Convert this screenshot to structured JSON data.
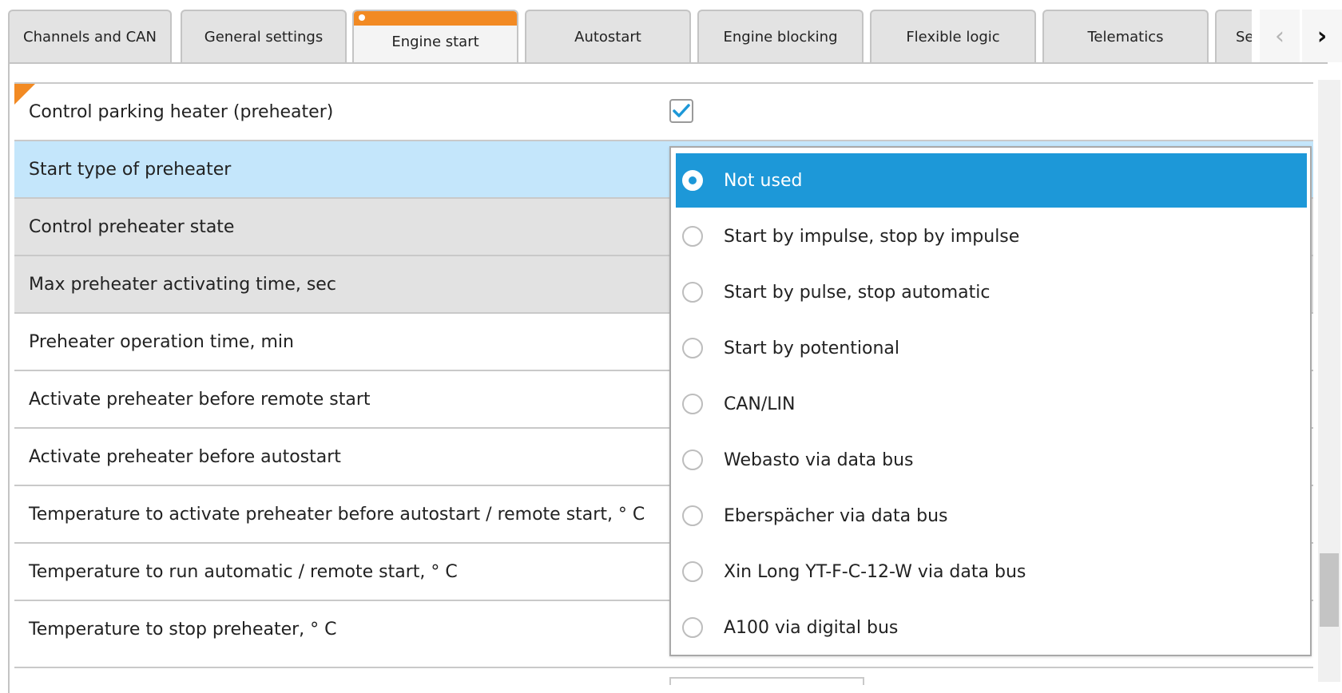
{
  "tabs": [
    {
      "label": "Channels and CAN"
    },
    {
      "label": "General settings"
    },
    {
      "label": "Engine start",
      "active": true
    },
    {
      "label": "Autostart"
    },
    {
      "label": "Engine blocking"
    },
    {
      "label": "Flexible logic"
    },
    {
      "label": "Telematics"
    },
    {
      "label": "Se"
    }
  ],
  "tab_nav": {
    "prev_icon": "chevron-left-icon",
    "next_icon": "chevron-right-icon",
    "prev_glyph": "‹",
    "next_glyph": "›"
  },
  "settings": {
    "rows": [
      {
        "label": "Control parking heater (preheater)",
        "checked": true
      },
      {
        "label": "Start type of preheater"
      },
      {
        "label": "Control preheater state"
      },
      {
        "label": "Max preheater activating time, sec"
      },
      {
        "label": "Preheater operation time, min"
      },
      {
        "label": "Activate preheater before remote start"
      },
      {
        "label": "Activate preheater before autostart"
      },
      {
        "label": "Temperature to activate preheater before autostart / remote start, ° C"
      },
      {
        "label": "Temperature to run automatic / remote start, ° C"
      },
      {
        "label": "Temperature to stop preheater, ° C"
      }
    ]
  },
  "start_type_dropdown": {
    "selected": "Not used",
    "options": [
      "Not used",
      "Start by impulse, stop by impulse",
      "Start by pulse, stop automatic",
      "Start by potentional",
      "CAN/LIN",
      "Webasto via data bus",
      "Eberspächer via data bus",
      "Xin Long YT-F-C-12-W via data bus",
      "A100 via digital bus"
    ]
  },
  "colors": {
    "accent_orange": "#f28a23",
    "selection_blue": "#1d98d8",
    "row_highlight": "#c4e6fb",
    "row_disabled": "#e2e2e2",
    "checkmark": "#1d98d8"
  }
}
